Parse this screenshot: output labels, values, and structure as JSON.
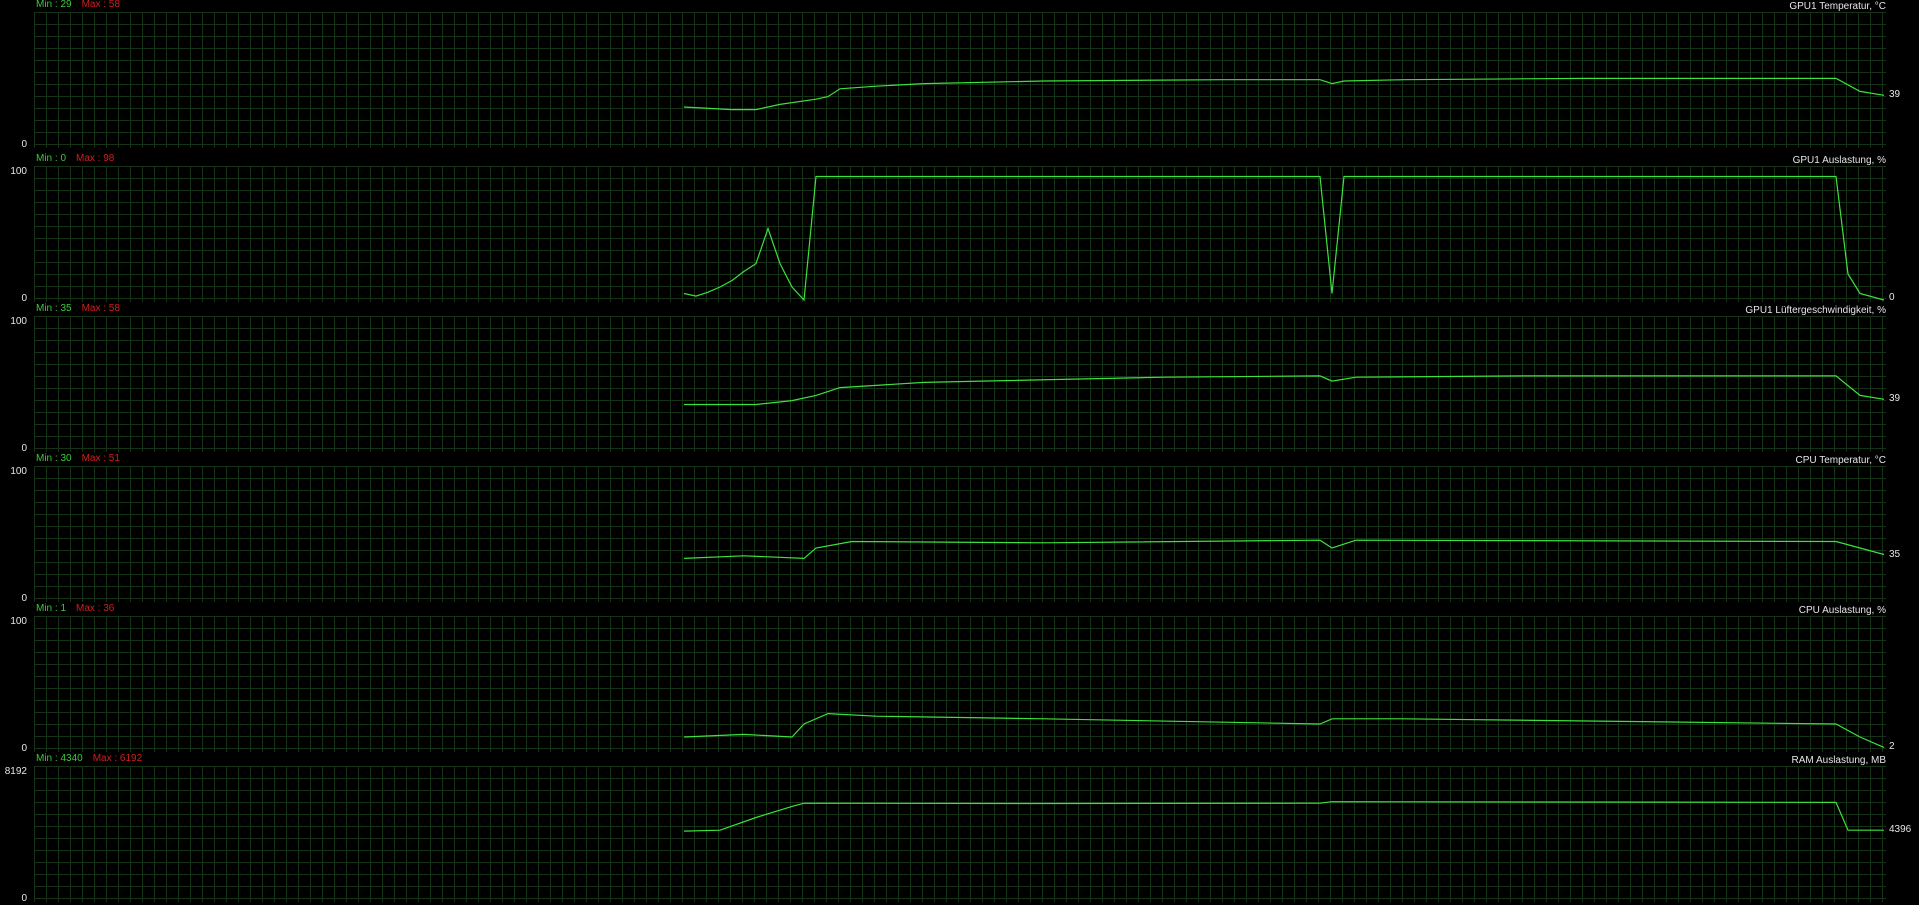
{
  "colors": {
    "background": "#000000",
    "grid": "#173317",
    "trace": "#3ce23c",
    "min_text": "#3dc93d",
    "max_text": "#cc2020",
    "label_text": "#e6e6e6"
  },
  "panels": [
    {
      "title": "GPU1 Temperatur, °C",
      "min_label": "Min : 29",
      "max_label": "Max : 58",
      "y_min_label": "0",
      "y_max_label": "",
      "current_label": "39",
      "current_value": 39,
      "y_range": [
        0,
        100
      ],
      "trace": [
        [
          0,
          30
        ],
        [
          4,
          28
        ],
        [
          6,
          28
        ],
        [
          8,
          32
        ],
        [
          11,
          36
        ],
        [
          12,
          38
        ],
        [
          13,
          44
        ],
        [
          16,
          46
        ],
        [
          20,
          48
        ],
        [
          30,
          50
        ],
        [
          45,
          51
        ],
        [
          53,
          51
        ],
        [
          54,
          48
        ],
        [
          55,
          50
        ],
        [
          60,
          51
        ],
        [
          75,
          52
        ],
        [
          90,
          52
        ],
        [
          96,
          52
        ],
        [
          98,
          42
        ],
        [
          100,
          39
        ]
      ]
    },
    {
      "title": "GPU1 Auslastung, %",
      "min_label": "Min : 0",
      "max_label": "Max : 98",
      "y_min_label": "0",
      "y_max_label": "100",
      "current_label": "0",
      "current_value": 0,
      "y_range": [
        0,
        100
      ],
      "trace": [
        [
          0,
          5
        ],
        [
          1,
          3
        ],
        [
          2,
          6
        ],
        [
          3,
          10
        ],
        [
          4,
          15
        ],
        [
          5,
          22
        ],
        [
          6,
          28
        ],
        [
          7,
          55
        ],
        [
          8,
          28
        ],
        [
          9,
          10
        ],
        [
          10,
          0
        ],
        [
          11,
          95
        ],
        [
          25,
          95
        ],
        [
          53,
          95
        ],
        [
          54,
          5
        ],
        [
          55,
          95
        ],
        [
          96,
          95
        ],
        [
          97,
          20
        ],
        [
          98,
          5
        ],
        [
          100,
          0
        ]
      ]
    },
    {
      "title": "GPU1 Lüftergeschwindigkeit, %",
      "min_label": "Min : 35",
      "max_label": "Max : 58",
      "y_min_label": "0",
      "y_max_label": "100",
      "current_label": "39",
      "current_value": 39,
      "y_range": [
        0,
        100
      ],
      "trace": [
        [
          0,
          35
        ],
        [
          6,
          35
        ],
        [
          9,
          38
        ],
        [
          11,
          42
        ],
        [
          13,
          48
        ],
        [
          20,
          52
        ],
        [
          40,
          56
        ],
        [
          53,
          57
        ],
        [
          54,
          53
        ],
        [
          56,
          56
        ],
        [
          70,
          57
        ],
        [
          96,
          57
        ],
        [
          98,
          42
        ],
        [
          100,
          39
        ]
      ]
    },
    {
      "title": "CPU Temperatur, °C",
      "min_label": "Min : 30",
      "max_label": "Max : 51",
      "y_min_label": "0",
      "y_max_label": "100",
      "current_label": "35",
      "current_value": 35,
      "y_range": [
        0,
        100
      ],
      "trace": [
        [
          0,
          32
        ],
        [
          5,
          34
        ],
        [
          10,
          32
        ],
        [
          11,
          40
        ],
        [
          14,
          45
        ],
        [
          30,
          44
        ],
        [
          53,
          46
        ],
        [
          54,
          40
        ],
        [
          56,
          46
        ],
        [
          96,
          45
        ],
        [
          98,
          40
        ],
        [
          100,
          35
        ]
      ]
    },
    {
      "title": "CPU Auslastung, %",
      "min_label": "Min : 1",
      "max_label": "Max : 36",
      "y_min_label": "0",
      "y_max_label": "100",
      "current_label": "2",
      "current_value": 2,
      "y_range": [
        0,
        100
      ],
      "trace": [
        [
          0,
          10
        ],
        [
          5,
          12
        ],
        [
          9,
          10
        ],
        [
          10,
          20
        ],
        [
          12,
          28
        ],
        [
          16,
          26
        ],
        [
          30,
          24
        ],
        [
          53,
          20
        ],
        [
          54,
          24
        ],
        [
          60,
          24
        ],
        [
          96,
          20
        ],
        [
          98,
          10
        ],
        [
          100,
          2
        ]
      ]
    },
    {
      "title": "RAM Auslastung, MB",
      "min_label": "Min : 4340",
      "max_label": "Max : 6192",
      "y_min_label": "0",
      "y_max_label": "8192",
      "current_label": "4396",
      "current_value": 4396,
      "y_range": [
        0,
        8192
      ],
      "trace": [
        [
          0,
          4340
        ],
        [
          3,
          4400
        ],
        [
          6,
          5200
        ],
        [
          9,
          5900
        ],
        [
          10,
          6100
        ],
        [
          30,
          6080
        ],
        [
          53,
          6100
        ],
        [
          54,
          6192
        ],
        [
          96,
          6150
        ],
        [
          97,
          4396
        ],
        [
          100,
          4396
        ]
      ]
    }
  ]
}
